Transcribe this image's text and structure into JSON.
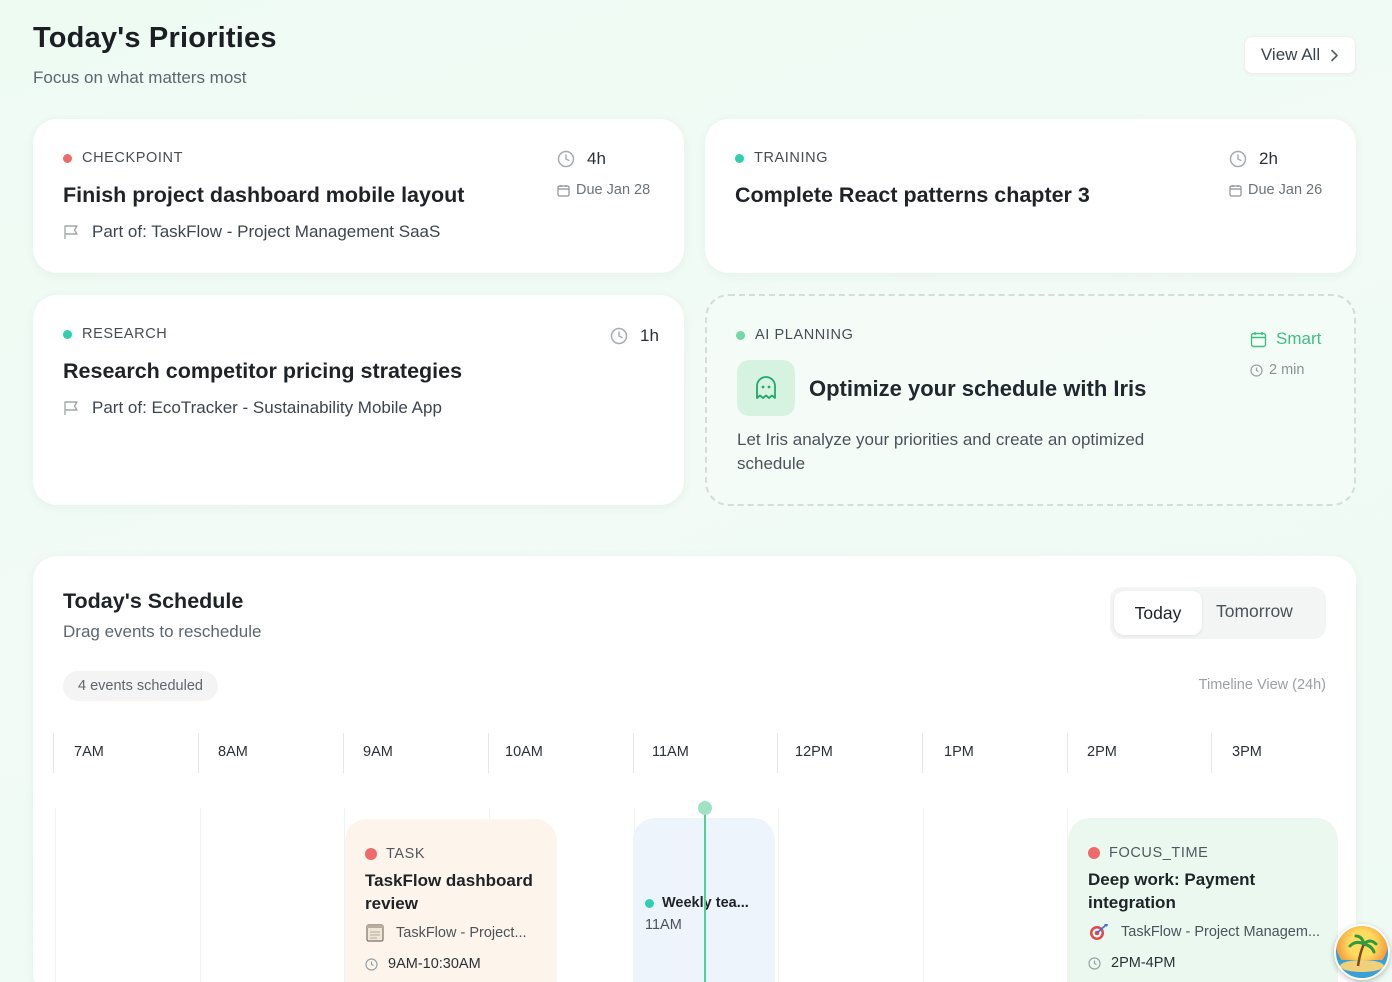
{
  "header": {
    "title": "Today's Priorities",
    "subtitle": "Focus on what matters most",
    "view_all": "View All"
  },
  "priorities": [
    {
      "category": "CHECKPOINT",
      "dot_color": "#ef6b6b",
      "title": "Finish project dashboard mobile layout",
      "part": "Part of: TaskFlow - Project Management SaaS",
      "duration": "4h",
      "due": "Due Jan 28"
    },
    {
      "category": "TRAINING",
      "dot_color": "#2fcfb2",
      "title": "Complete React patterns chapter 3",
      "duration": "2h",
      "due": "Due Jan 26"
    },
    {
      "category": "RESEARCH",
      "dot_color": "#2fcfb2",
      "title": "Research competitor pricing strategies",
      "part": "Part of: EcoTracker - Sustainability Mobile App",
      "duration": "1h"
    }
  ],
  "ai_planning": {
    "category": "AI PLANNING",
    "title": "Optimize your schedule with Iris",
    "description": "Let Iris analyze your priorities and create an optimized schedule",
    "smart": "Smart",
    "duration": "2 min"
  },
  "schedule": {
    "title": "Today's Schedule",
    "subtitle": "Drag events to reschedule",
    "tabs": {
      "today": "Today",
      "tomorrow": "Tomorrow"
    },
    "events_count": "4 events scheduled",
    "view_label": "Timeline View (24h)",
    "hours": [
      "7AM",
      "8AM",
      "9AM",
      "10AM",
      "11AM",
      "12PM",
      "1PM",
      "2PM",
      "3PM"
    ],
    "events": [
      {
        "category": "TASK",
        "dot_color": "#ef6b6b",
        "title": "TaskFlow dashboard review",
        "project": "TaskFlow - Project...",
        "time": "9AM-10:30AM"
      },
      {
        "title": "Weekly tea...",
        "dot_color": "#2fcfb2",
        "time": "11AM"
      },
      {
        "category": "FOCUS_TIME",
        "dot_color": "#ef6b6b",
        "title": "Deep work: Payment integration",
        "project": "TaskFlow - Project Managem...",
        "time": "2PM-4PM"
      }
    ]
  }
}
